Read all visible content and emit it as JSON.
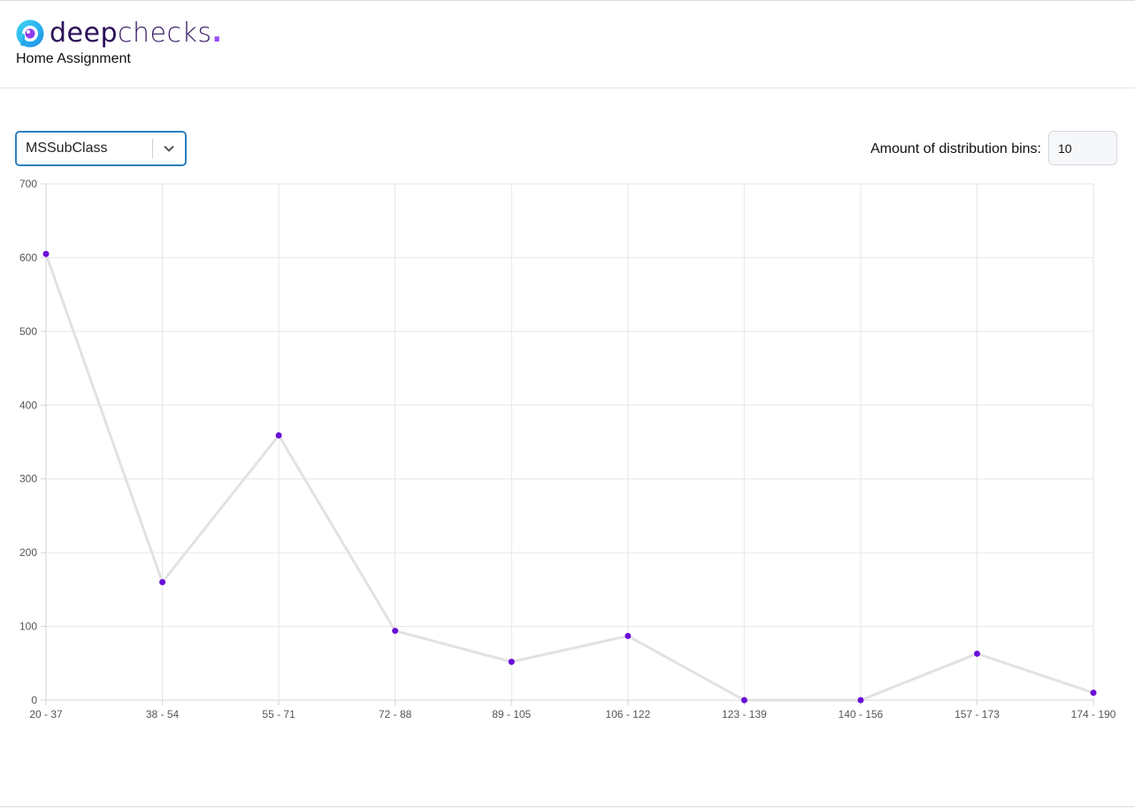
{
  "app": {
    "logo_part1": "deep",
    "logo_part2": "checks",
    "logo_dot": ".",
    "subtitle": "Home Assignment"
  },
  "controls": {
    "column_select_value": "MSSubClass",
    "bins_label": "Amount of distribution bins:",
    "bins_value": "10"
  },
  "colors": {
    "accent": "#2d7fbf",
    "point": "#6a0fd8",
    "line": "#e2e2e2",
    "logo_dark": "#2b0f57",
    "logo_accent": "#9a4dff"
  },
  "chart_data": {
    "type": "line",
    "categories": [
      "20 - 37",
      "38 - 54",
      "55 - 71",
      "72 - 88",
      "89 - 105",
      "106 - 122",
      "123 - 139",
      "140 - 156",
      "157 - 173",
      "174 - 190"
    ],
    "values": [
      605,
      160,
      359,
      94,
      52,
      87,
      0,
      0,
      63,
      10
    ],
    "ylim": [
      0,
      700
    ],
    "yticks": [
      0,
      100,
      200,
      300,
      400,
      500,
      600,
      700
    ],
    "grid": true,
    "title": "",
    "xlabel": "",
    "ylabel": ""
  }
}
